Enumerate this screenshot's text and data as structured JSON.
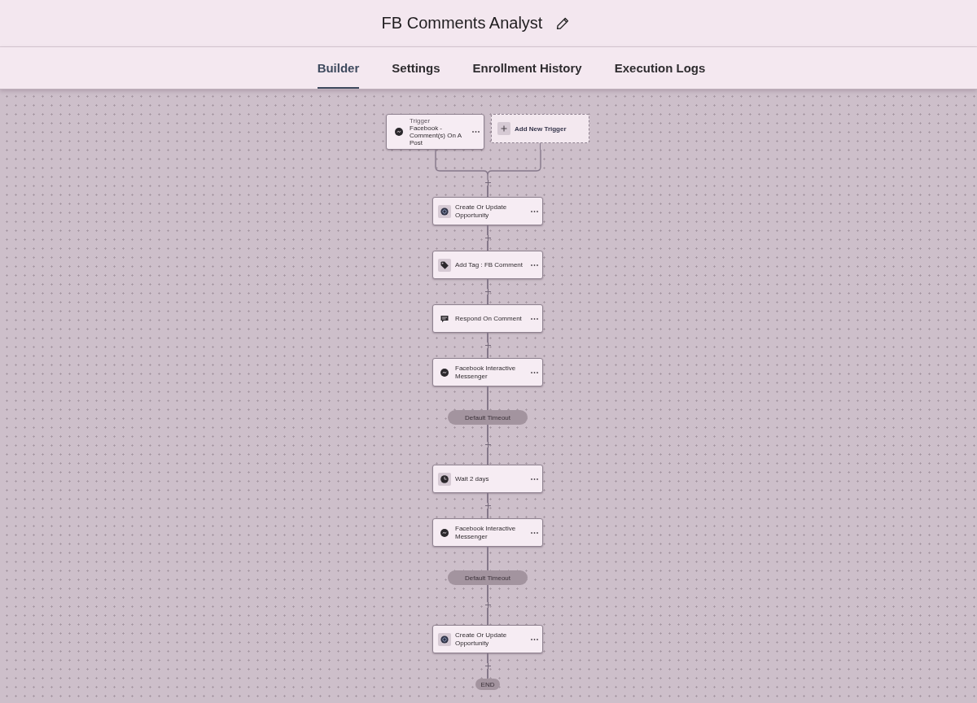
{
  "header": {
    "title": "FB Comments Analyst"
  },
  "tabs": [
    {
      "label": "Builder",
      "selected": true
    },
    {
      "label": "Settings",
      "selected": false
    },
    {
      "label": "Enrollment History",
      "selected": false
    },
    {
      "label": "Execution Logs",
      "selected": false
    }
  ],
  "trigger": {
    "label": "Trigger",
    "event": "Facebook - Comment(s) On A Post"
  },
  "add_trigger": {
    "label": "Add New Trigger"
  },
  "steps": [
    {
      "kind": "opportunity",
      "label": "Create Or Update Opportunity"
    },
    {
      "kind": "tag",
      "label": "Add Tag : FB Comment"
    },
    {
      "kind": "reply",
      "label": "Respond On Comment"
    },
    {
      "kind": "messenger",
      "label": "Facebook Interactive Messenger"
    },
    {
      "kind": "branch",
      "label": "Default Timeout"
    },
    {
      "kind": "wait",
      "label": "Wait 2 days"
    },
    {
      "kind": "messenger",
      "label": "Facebook Interactive Messenger"
    },
    {
      "kind": "branch",
      "label": "Default Timeout"
    },
    {
      "kind": "opportunity",
      "label": "Create Or Update Opportunity"
    },
    {
      "kind": "end",
      "label": "END"
    }
  ]
}
